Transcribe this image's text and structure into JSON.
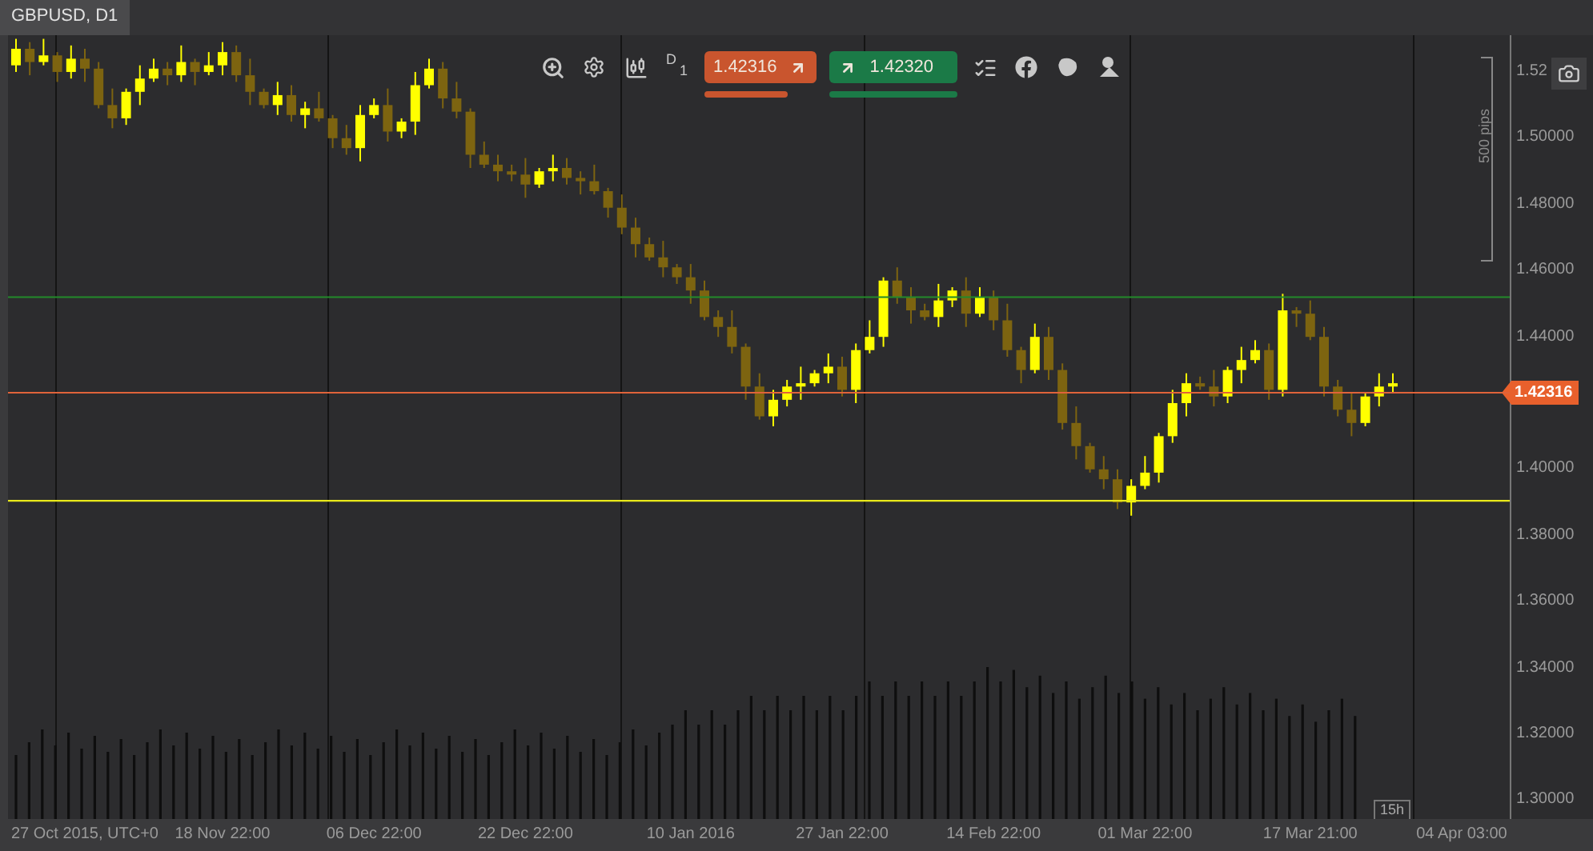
{
  "tab": {
    "label": "GBPUSD, D1",
    "selected": true
  },
  "toolbar": {
    "timeframe_letter": "D",
    "timeframe_number": "1",
    "sell_price": "1.42316",
    "buy_price": "1.42320"
  },
  "ruler": {
    "label": "500 pips"
  },
  "chart_data": {
    "type": "candlestick",
    "ylim": [
      1.2944,
      1.5311
    ],
    "categories": [
      null,
      null,
      null,
      null,
      null,
      "27 Oct 2015, UTC+0",
      null,
      null,
      null,
      null,
      null,
      null,
      null,
      null,
      null,
      "18 Nov 22:00",
      null,
      null,
      null,
      null,
      null,
      null,
      null,
      null,
      null,
      null,
      "06 Dec 22:00",
      null,
      null,
      null,
      null,
      null,
      null,
      null,
      null,
      null,
      null,
      "22 Dec 22:00",
      null,
      null,
      null,
      null,
      null,
      null,
      null,
      null,
      null,
      null,
      null,
      "10 Jan 2016",
      null,
      null,
      null,
      null,
      null,
      null,
      null,
      null,
      null,
      null,
      "27 Jan 22:00",
      null,
      null,
      null,
      null,
      null,
      null,
      null,
      null,
      null,
      null,
      "14 Feb 22:00",
      null,
      null,
      null,
      null,
      null,
      null,
      null,
      null,
      null,
      null,
      "01 Mar 22:00",
      null,
      null,
      null,
      null,
      null,
      null,
      null,
      null,
      null,
      null,
      null,
      "17 Mar 21:00",
      null,
      null,
      null,
      null,
      null,
      null,
      null,
      null,
      null,
      null,
      "04 Apr 03:00"
    ],
    "yticks": [
      {
        "value": 1.52,
        "label": "1.52"
      },
      {
        "value": 1.5,
        "label": "1.50000"
      },
      {
        "value": 1.48,
        "label": "1.48000"
      },
      {
        "value": 1.46,
        "label": "1.46000"
      },
      {
        "value": 1.44,
        "label": "1.44000"
      },
      {
        "value": 1.4,
        "label": "1.40000"
      },
      {
        "value": 1.38,
        "label": "1.38000"
      },
      {
        "value": 1.36,
        "label": "1.36000"
      },
      {
        "value": 1.34,
        "label": "1.34000"
      },
      {
        "value": 1.32,
        "label": "1.32000"
      },
      {
        "value": 1.3,
        "label": "1.30000"
      }
    ],
    "ohlc": [
      [
        1.522,
        1.53,
        1.52,
        1.527
      ],
      [
        1.527,
        1.529,
        1.519,
        1.523
      ],
      [
        1.523,
        1.53,
        1.522,
        1.525
      ],
      [
        1.525,
        1.526,
        1.517,
        1.52
      ],
      [
        1.52,
        1.528,
        1.518,
        1.524
      ],
      [
        1.524,
        1.527,
        1.517,
        1.521
      ],
      [
        1.521,
        1.523,
        1.509,
        1.51
      ],
      [
        1.51,
        1.515,
        1.503,
        1.506
      ],
      [
        1.506,
        1.515,
        1.504,
        1.514
      ],
      [
        1.514,
        1.522,
        1.51,
        1.518
      ],
      [
        1.518,
        1.524,
        1.517,
        1.521
      ],
      [
        1.521,
        1.523,
        1.516,
        1.519
      ],
      [
        1.519,
        1.528,
        1.517,
        1.523
      ],
      [
        1.523,
        1.524,
        1.516,
        1.52
      ],
      [
        1.52,
        1.526,
        1.519,
        1.522
      ],
      [
        1.522,
        1.529,
        1.519,
        1.526
      ],
      [
        1.526,
        1.528,
        1.517,
        1.519
      ],
      [
        1.519,
        1.524,
        1.51,
        1.514
      ],
      [
        1.514,
        1.515,
        1.509,
        1.51
      ],
      [
        1.51,
        1.517,
        1.507,
        1.513
      ],
      [
        1.513,
        1.516,
        1.505,
        1.507
      ],
      [
        1.507,
        1.511,
        1.503,
        1.509
      ],
      [
        1.509,
        1.514,
        1.505,
        1.506
      ],
      [
        1.506,
        1.507,
        1.497,
        1.5
      ],
      [
        1.5,
        1.504,
        1.495,
        1.497
      ],
      [
        1.497,
        1.51,
        1.493,
        1.507
      ],
      [
        1.507,
        1.512,
        1.506,
        1.51
      ],
      [
        1.51,
        1.515,
        1.499,
        1.502
      ],
      [
        1.502,
        1.506,
        1.5,
        1.505
      ],
      [
        1.505,
        1.52,
        1.501,
        1.516
      ],
      [
        1.516,
        1.524,
        1.515,
        1.521
      ],
      [
        1.521,
        1.523,
        1.509,
        1.512
      ],
      [
        1.512,
        1.517,
        1.506,
        1.508
      ],
      [
        1.508,
        1.509,
        1.491,
        1.495
      ],
      [
        1.495,
        1.499,
        1.491,
        1.492
      ],
      [
        1.492,
        1.495,
        1.487,
        1.49
      ],
      [
        1.49,
        1.492,
        1.487,
        1.489
      ],
      [
        1.489,
        1.494,
        1.482,
        1.486
      ],
      [
        1.486,
        1.491,
        1.485,
        1.49
      ],
      [
        1.49,
        1.495,
        1.487,
        1.491
      ],
      [
        1.491,
        1.494,
        1.486,
        1.488
      ],
      [
        1.488,
        1.49,
        1.483,
        1.487
      ],
      [
        1.487,
        1.492,
        1.483,
        1.484
      ],
      [
        1.484,
        1.485,
        1.476,
        1.479
      ],
      [
        1.479,
        1.483,
        1.471,
        1.473
      ],
      [
        1.473,
        1.476,
        1.464,
        1.468
      ],
      [
        1.468,
        1.47,
        1.463,
        1.464
      ],
      [
        1.464,
        1.469,
        1.458,
        1.461
      ],
      [
        1.461,
        1.462,
        1.456,
        1.458
      ],
      [
        1.458,
        1.462,
        1.45,
        1.454
      ],
      [
        1.454,
        1.457,
        1.445,
        1.446
      ],
      [
        1.446,
        1.448,
        1.44,
        1.443
      ],
      [
        1.443,
        1.448,
        1.435,
        1.437
      ],
      [
        1.437,
        1.438,
        1.421,
        1.425
      ],
      [
        1.425,
        1.429,
        1.415,
        1.416
      ],
      [
        1.416,
        1.424,
        1.413,
        1.421
      ],
      [
        1.421,
        1.427,
        1.419,
        1.425
      ],
      [
        1.425,
        1.431,
        1.421,
        1.426
      ],
      [
        1.426,
        1.43,
        1.425,
        1.429
      ],
      [
        1.429,
        1.435,
        1.426,
        1.431
      ],
      [
        1.431,
        1.434,
        1.422,
        1.424
      ],
      [
        1.424,
        1.438,
        1.42,
        1.436
      ],
      [
        1.436,
        1.445,
        1.435,
        1.44
      ],
      [
        1.44,
        1.458,
        1.437,
        1.457
      ],
      [
        1.457,
        1.461,
        1.45,
        1.452
      ],
      [
        1.452,
        1.455,
        1.444,
        1.448
      ],
      [
        1.448,
        1.45,
        1.445,
        1.446
      ],
      [
        1.446,
        1.456,
        1.443,
        1.451
      ],
      [
        1.451,
        1.455,
        1.449,
        1.454
      ],
      [
        1.454,
        1.458,
        1.443,
        1.447
      ],
      [
        1.447,
        1.455,
        1.446,
        1.452
      ],
      [
        1.452,
        1.454,
        1.442,
        1.445
      ],
      [
        1.445,
        1.45,
        1.434,
        1.436
      ],
      [
        1.436,
        1.437,
        1.426,
        1.43
      ],
      [
        1.43,
        1.444,
        1.429,
        1.44
      ],
      [
        1.44,
        1.443,
        1.427,
        1.43
      ],
      [
        1.43,
        1.432,
        1.412,
        1.414
      ],
      [
        1.414,
        1.419,
        1.403,
        1.407
      ],
      [
        1.407,
        1.408,
        1.399,
        1.4
      ],
      [
        1.4,
        1.404,
        1.394,
        1.397
      ],
      [
        1.397,
        1.4,
        1.388,
        1.39
      ],
      [
        1.39,
        1.397,
        1.386,
        1.395
      ],
      [
        1.395,
        1.404,
        1.394,
        1.399
      ],
      [
        1.399,
        1.411,
        1.396,
        1.41
      ],
      [
        1.41,
        1.424,
        1.408,
        1.42
      ],
      [
        1.42,
        1.429,
        1.416,
        1.426
      ],
      [
        1.426,
        1.428,
        1.424,
        1.425
      ],
      [
        1.425,
        1.43,
        1.419,
        1.422
      ],
      [
        1.422,
        1.431,
        1.42,
        1.43
      ],
      [
        1.43,
        1.437,
        1.426,
        1.433
      ],
      [
        1.433,
        1.439,
        1.432,
        1.436
      ],
      [
        1.436,
        1.438,
        1.421,
        1.424
      ],
      [
        1.424,
        1.453,
        1.422,
        1.448
      ],
      [
        1.448,
        1.449,
        1.443,
        1.447
      ],
      [
        1.447,
        1.451,
        1.439,
        1.44
      ],
      [
        1.44,
        1.443,
        1.422,
        1.425
      ],
      [
        1.425,
        1.427,
        1.416,
        1.418
      ],
      [
        1.418,
        1.423,
        1.41,
        1.414
      ],
      [
        1.414,
        1.423,
        1.413,
        1.422
      ],
      [
        1.422,
        1.429,
        1.419,
        1.425
      ],
      [
        1.425,
        1.429,
        1.423,
        1.426
      ],
      null,
      null,
      null,
      null,
      null
    ]
  },
  "current_price": "1.42316",
  "countdown": "15h"
}
